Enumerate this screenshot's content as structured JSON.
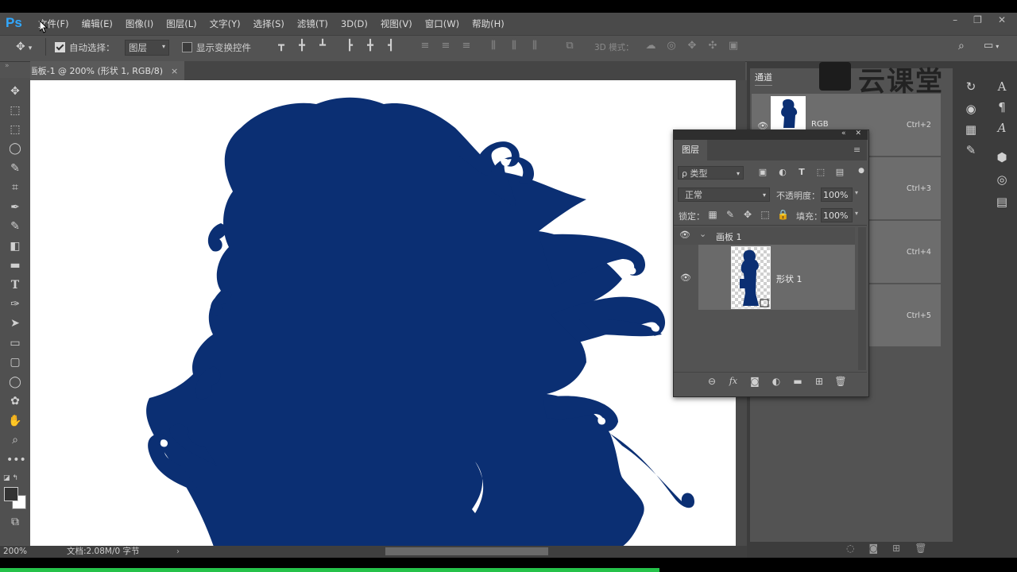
{
  "app": {
    "logo": "Ps"
  },
  "menu": [
    "文件(F)",
    "编辑(E)",
    "图像(I)",
    "图层(L)",
    "文字(Y)",
    "选择(S)",
    "滤镜(T)",
    "3D(D)",
    "视图(V)",
    "窗口(W)",
    "帮助(H)"
  ],
  "window_controls": [
    "–",
    "❐",
    "✕"
  ],
  "options": {
    "auto_select_label": "自动选择：",
    "auto_select_value": "图层",
    "show_transform_label": "显示变换控件",
    "mode_3d_label": "3D 模式："
  },
  "document": {
    "tab_title": "画板-1 @ 200% (形状 1, RGB/8) *",
    "tab_close": "×",
    "zoom": "200%",
    "info": "文档:2.08M/0 字节"
  },
  "channels": {
    "tab": "通道",
    "rows": [
      {
        "name": "RGB",
        "shortcut": "Ctrl+2"
      },
      {
        "name": "",
        "shortcut": "Ctrl+3"
      },
      {
        "name": "",
        "shortcut": "Ctrl+4"
      },
      {
        "name": "",
        "shortcut": "Ctrl+5"
      }
    ]
  },
  "watermark": "云课堂",
  "layers": {
    "tab": "图层",
    "filter_kind": "ρ 类型",
    "blend_mode": "正常",
    "opacity_label": "不透明度：",
    "opacity_value": "100%",
    "lock_label": "锁定：",
    "fill_label": "填充：",
    "fill_value": "100%",
    "artboard_name": "画板 1",
    "shape_layer_name": "形状 1",
    "bottom_icons": [
      "link-icon",
      "fx-icon",
      "mask-icon",
      "adjustment-icon",
      "folder-icon",
      "new-layer-icon",
      "trash-icon"
    ],
    "bottom_icon_glyphs": [
      "⊖",
      "fx",
      "◙",
      "◐",
      "▬",
      "⊞",
      "🗑"
    ]
  },
  "colors": {
    "silhouette": "#0b2f73",
    "accent_ps": "#31a8ff",
    "progress_green": "#25c24a"
  }
}
